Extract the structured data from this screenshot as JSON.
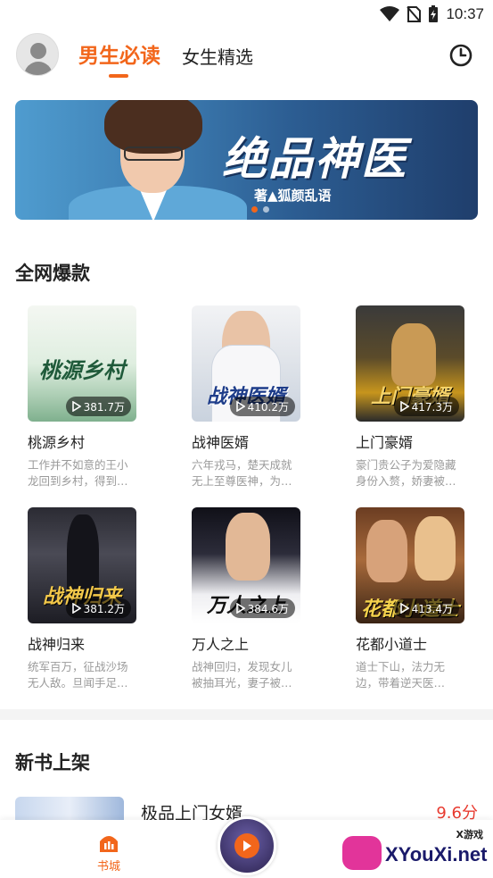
{
  "status_bar": {
    "time": "10:37"
  },
  "header": {
    "tabs": [
      {
        "label": "男生必读",
        "active": true
      },
      {
        "label": "女生精选",
        "active": false
      }
    ]
  },
  "banner": {
    "title": "绝品神医",
    "author": "著▲狐颜乱语",
    "dots": 2,
    "active_dot": 0
  },
  "sections": {
    "hot_title": "全网爆款",
    "new_title": "新书上架"
  },
  "books": [
    {
      "title": "桃源乡村",
      "reads": "381.7万",
      "desc": "工作并不如意的王小龙回到乡村，得到…",
      "cover_text": "桃源乡村"
    },
    {
      "title": "战神医婿",
      "reads": "410.2万",
      "desc": "六年戎马，楚天成就无上至尊医神，为…",
      "cover_text": "战神医婿"
    },
    {
      "title": "上门豪婿",
      "reads": "417.3万",
      "desc": "豪门贵公子为爱隐藏身份入赘，娇妻被…",
      "cover_text": "上门豪婿"
    },
    {
      "title": "战神归来",
      "reads": "381.2万",
      "desc": "统军百万，征战沙场无人敌。旦闻手足…",
      "cover_text": "战神归来"
    },
    {
      "title": "万人之上",
      "reads": "384.6万",
      "desc": "战神回归，发现女儿被抽耳光，妻子被…",
      "cover_text": "万人之上"
    },
    {
      "title": "花都小道士",
      "reads": "413.4万",
      "desc": "道士下山，法力无边，带着逆天医…",
      "cover_text": "花都小道士"
    }
  ],
  "new_book": {
    "title": "极品上门女婿",
    "score": "9.6分"
  },
  "bottom_nav": {
    "bookstore_label": "书城",
    "watermark_small": "X游戏",
    "watermark_big": "XYouXi.net"
  },
  "colors": {
    "accent": "#f2661b",
    "score": "#e83a2f"
  }
}
